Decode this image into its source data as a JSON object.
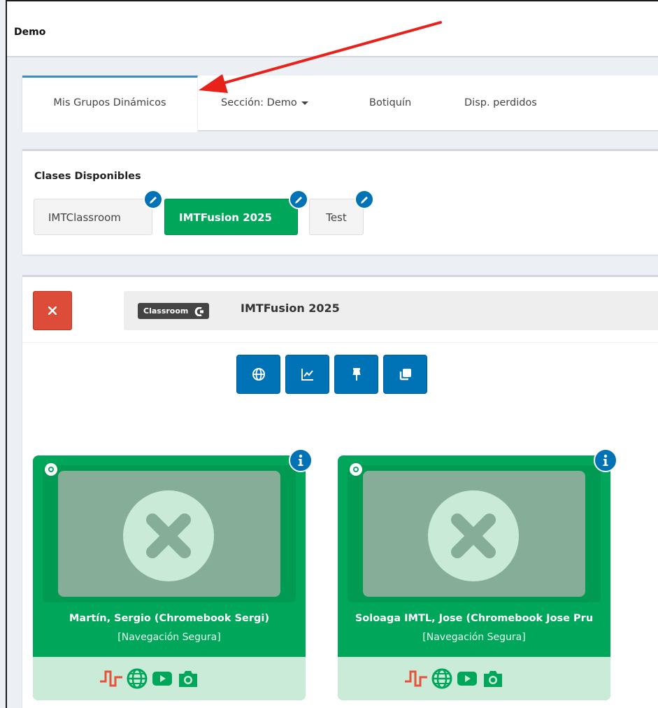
{
  "header": {
    "title": "Demo"
  },
  "tabs": {
    "groups": "Mis Grupos Dinámicos",
    "section": "Sección: Demo",
    "kit": "Botiquín",
    "lost": "Disp. perdidos"
  },
  "classes": {
    "title": "Clases Disponibles",
    "items": [
      {
        "label": "IMTClassroom",
        "active": false
      },
      {
        "label": "IMTFusion 2025",
        "active": true
      },
      {
        "label": "Test",
        "active": false
      }
    ]
  },
  "room": {
    "badge": "Classroom",
    "name": "IMTFusion 2025",
    "tools": [
      "globe-icon",
      "chart-icon",
      "pin-icon",
      "clone-icon"
    ]
  },
  "devices": [
    {
      "name": "Martín, Sergio (Chromebook Sergi)",
      "status": "[Navegación Segura]"
    },
    {
      "name": "Soloaga IMTL, Jose (Chromebook Jose Pru",
      "status": "[Navegación Segura]"
    }
  ],
  "colors": {
    "active_green": "#00a65a",
    "primary_blue": "#0073b7",
    "danger_red": "#dd4b39",
    "arrow_red": "#e8221a",
    "pulse_red": "#e8513a"
  }
}
